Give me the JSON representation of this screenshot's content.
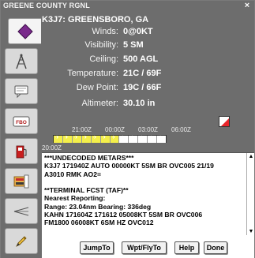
{
  "window": {
    "title": "GREENE COUNTY RGNL",
    "close_glyph": "×"
  },
  "toolbar": {
    "items": [
      {
        "icon": "diamond-icon",
        "active": true
      },
      {
        "icon": "tower-icon",
        "active": false
      },
      {
        "icon": "speech-bubble-icon",
        "active": false
      },
      {
        "icon": "fbo-icon",
        "label": "FBO",
        "active": false
      },
      {
        "icon": "fuel-pump-icon",
        "active": false
      },
      {
        "icon": "runway-chart-icon",
        "active": false
      },
      {
        "icon": "approach-icon",
        "active": false
      },
      {
        "icon": "pencil-icon",
        "active": false
      }
    ]
  },
  "weather": {
    "station": "K3J7: GREENSBORO, GA",
    "rows": [
      {
        "label": "Winds:",
        "value": "0@0KT"
      },
      {
        "label": "Visibility:",
        "value": "5 SM"
      },
      {
        "label": "Ceiling:",
        "value": "500 AGL"
      },
      {
        "label": "Temperature:",
        "value": "21C / 69F"
      },
      {
        "label": "Dew Point:",
        "value": "19C / 66F"
      },
      {
        "label": "Altimeter:",
        "value": "30.10 in"
      }
    ],
    "times": [
      "21:00Z",
      "00:00Z",
      "03:00Z",
      "06:00Z"
    ],
    "timeline_slots": [
      1,
      1,
      1,
      1,
      1,
      1,
      1,
      0,
      0,
      0,
      0,
      0
    ],
    "selected_time": "20:00Z",
    "alert_color": "#e8252a"
  },
  "report_text": {
    "lines": [
      "***UNDECODED METARS***",
      "K3J7 171940Z AUTO 00000KT 5SM BR OVC005 21/19",
      "A3010 RMK AO2=",
      "",
      "**TERMINAL FCST (TAF)**",
      "Nearest Reporting:",
      "Range: 23.04nm Bearing: 336deg",
      "KAHN 171604Z 171612 05008KT 5SM BR OVC006",
      "FM1800 06008KT 6SM HZ OVC012"
    ]
  },
  "buttons": {
    "jump": "JumpTo",
    "wpt": "Wpt/FlyTo",
    "help": "Help",
    "done": "Done"
  },
  "scroll": {
    "up": "▲",
    "down": "▼"
  }
}
